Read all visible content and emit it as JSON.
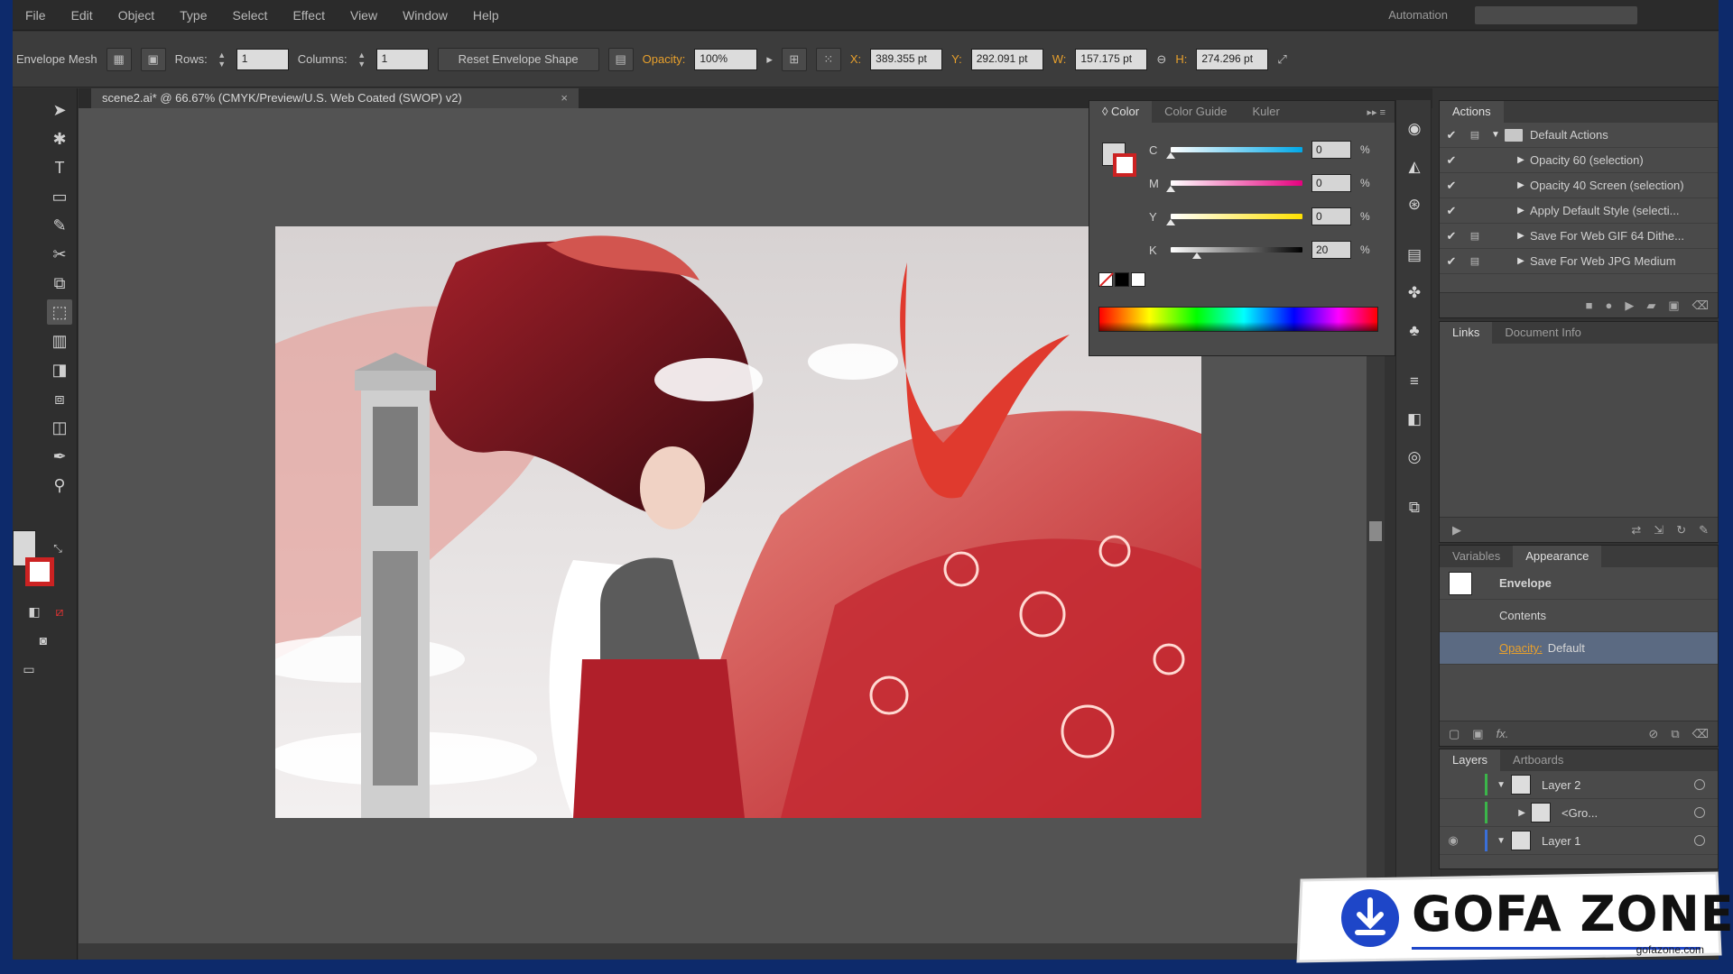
{
  "menubar": {
    "items": [
      "File",
      "Edit",
      "Object",
      "Type",
      "Select",
      "Effect",
      "View",
      "Window",
      "Help"
    ],
    "workspace": "Automation"
  },
  "controlbar": {
    "mode_label": "Envelope Mesh",
    "rows_label": "Rows:",
    "rows_value": "1",
    "columns_label": "Columns:",
    "columns_value": "1",
    "reset_label": "Reset Envelope Shape",
    "opacity_label": "Opacity:",
    "opacity_value": "100%",
    "x_label": "X:",
    "x_value": "389.355 pt",
    "y_label": "Y:",
    "y_value": "292.091 pt",
    "w_label": "W:",
    "w_value": "157.175 pt",
    "h_label": "H:",
    "h_value": "274.296 pt"
  },
  "document": {
    "tab_title": "scene2.ai* @ 66.67% (CMYK/Preview/U.S. Web Coated (SWOP) v2)",
    "tab_close": "×"
  },
  "color_panel": {
    "tabs": [
      "◊ Color",
      "Color Guide",
      "Kuler"
    ],
    "channels": [
      {
        "letter": "C",
        "value": "0",
        "unit": "%",
        "level": 0.0,
        "track": "linear-gradient(90deg,#ffffff,#00a8e8)"
      },
      {
        "letter": "M",
        "value": "0",
        "unit": "%",
        "level": 0.0,
        "track": "linear-gradient(90deg,#ffffff,#e5007e)"
      },
      {
        "letter": "Y",
        "value": "0",
        "unit": "%",
        "level": 0.0,
        "track": "linear-gradient(90deg,#ffffff,#ffe100)"
      },
      {
        "letter": "K",
        "value": "20",
        "unit": "%",
        "level": 0.2,
        "track": "linear-gradient(90deg,#ffffff,#000000)"
      }
    ]
  },
  "actions_panel": {
    "title": "Actions",
    "items": [
      {
        "label": "Default Actions",
        "type": "set"
      },
      {
        "label": "Opacity 60 (selection)",
        "type": "action"
      },
      {
        "label": "Opacity 40 Screen (selection)",
        "type": "action"
      },
      {
        "label": "Apply Default Style (selecti...",
        "type": "action"
      },
      {
        "label": "Save For Web GIF 64 Dithe...",
        "type": "action"
      },
      {
        "label": "Save For Web JPG Medium",
        "type": "action"
      }
    ]
  },
  "links_panel": {
    "tabs": [
      "Links",
      "Document Info"
    ]
  },
  "appearance_panel": {
    "tabs": [
      "Variables",
      "Appearance"
    ],
    "object_label": "Envelope",
    "contents_label": "Contents",
    "opacity_label": "Opacity:",
    "opacity_value": "Default",
    "fx_label": "fx."
  },
  "layers_panel": {
    "tabs": [
      "Layers",
      "Artboards"
    ],
    "rows": [
      {
        "label": "Layer 2",
        "indent": false
      },
      {
        "label": "<Gro...",
        "indent": true
      },
      {
        "label": "Layer 1",
        "indent": false
      }
    ]
  },
  "watermark": {
    "brand": "GOFA ZONE",
    "url": "gofazone.com"
  },
  "colors": {
    "accent_orange": "#e8a02c",
    "selection_blue": "#5b6a82",
    "layer_green": "#3bb54a",
    "layer_blue": "#3a6fd8"
  }
}
